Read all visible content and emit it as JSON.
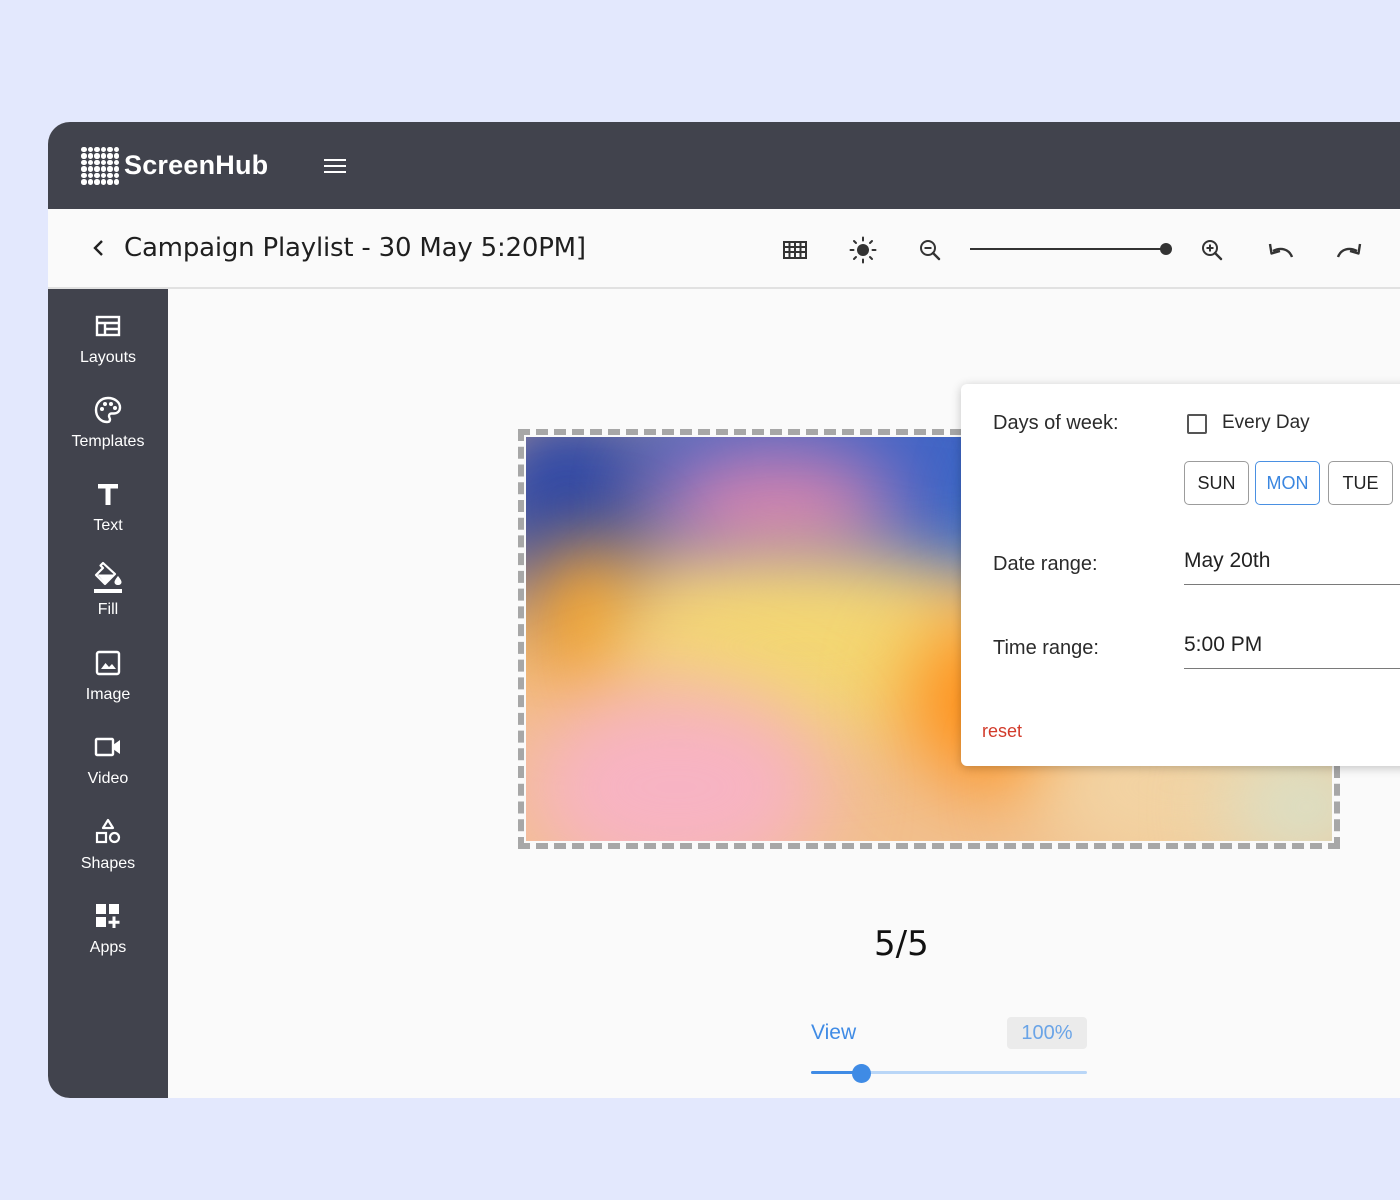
{
  "app": {
    "name": "ScreenHub"
  },
  "header": {
    "title": "Campaign Playlist - 30 May 5:20PM]"
  },
  "toolbar": {
    "icons": [
      "grid-icon",
      "brightness-icon",
      "zoom-out-icon",
      "zoom-slider",
      "zoom-in-icon",
      "undo-icon",
      "redo-icon"
    ]
  },
  "sidebar": {
    "items": [
      {
        "label": "Layouts",
        "icon": "layout-icon"
      },
      {
        "label": "Templates",
        "icon": "palette-icon"
      },
      {
        "label": "Text",
        "icon": "text-icon"
      },
      {
        "label": "Fill",
        "icon": "fill-icon"
      },
      {
        "label": "Image",
        "icon": "image-icon"
      },
      {
        "label": "Video",
        "icon": "video-icon"
      },
      {
        "label": "Shapes",
        "icon": "shapes-icon"
      },
      {
        "label": "Apps",
        "icon": "apps-icon"
      }
    ]
  },
  "schedule": {
    "days_label": "Days of week:",
    "every_day_label": "Every Day",
    "every_day_checked": false,
    "days": [
      {
        "label": "SUN",
        "selected": false
      },
      {
        "label": "MON",
        "selected": true
      },
      {
        "label": "TUE",
        "selected": false
      }
    ],
    "date_label": "Date range:",
    "date_value": "May 20th",
    "time_label": "Time range:",
    "time_value": "5:00 PM",
    "reset_label": "reset"
  },
  "canvas": {
    "page_indicator": "5/5"
  },
  "view": {
    "label": "View",
    "zoom_display": "100%",
    "slider_value": 0.18
  },
  "colors": {
    "topbar": "#41434d",
    "accent": "#3f8be5",
    "reset": "#d23a2a",
    "background": "#e3e8fd"
  }
}
